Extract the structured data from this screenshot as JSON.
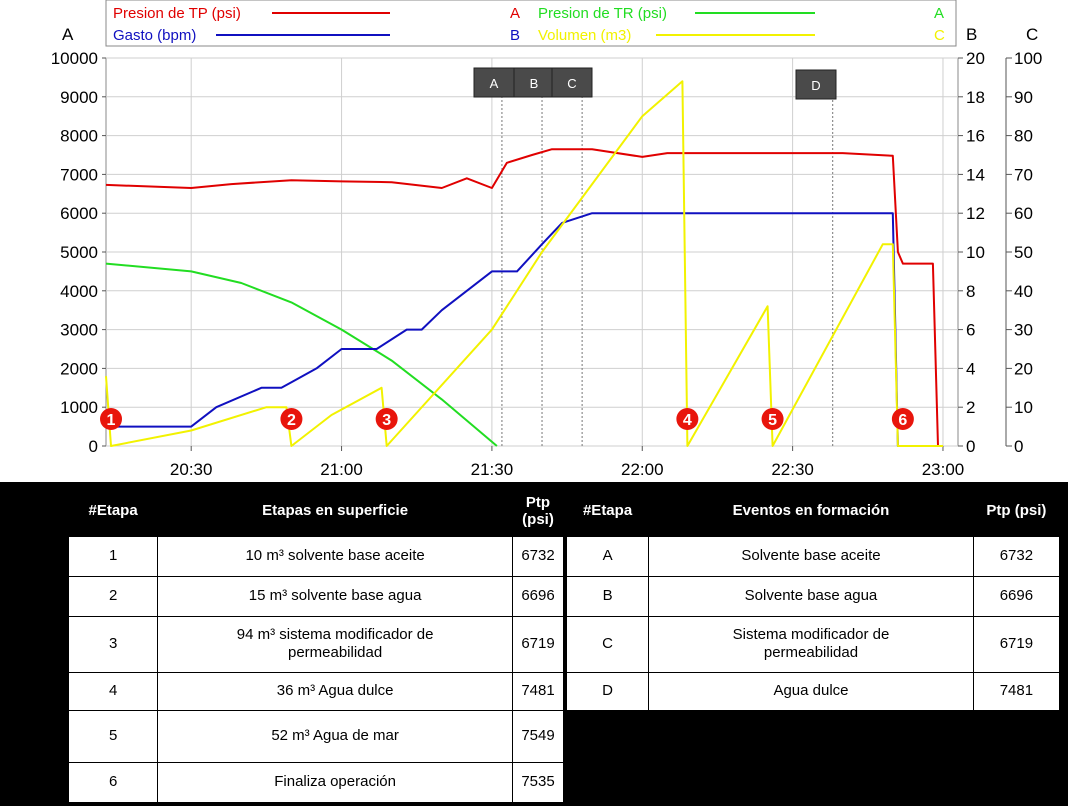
{
  "chart_data": {
    "type": "line",
    "x_ticks": [
      "20:30",
      "21:00",
      "21:30",
      "22:00",
      "22:30",
      "23:00"
    ],
    "x_range": [
      "20:13",
      "23:03"
    ],
    "axes": {
      "A": {
        "label": "A",
        "range": [
          0,
          10000
        ],
        "ticks": [
          "0",
          "1000",
          "2000",
          "3000",
          "4000",
          "5000",
          "6000",
          "7000",
          "8000",
          "9000",
          "10000"
        ]
      },
      "B": {
        "label": "B",
        "range": [
          0,
          20
        ],
        "ticks": [
          "0",
          "2",
          "4",
          "6",
          "8",
          "10",
          "12",
          "14",
          "16",
          "18",
          "20"
        ]
      },
      "C": {
        "label": "C",
        "range": [
          0,
          100
        ],
        "ticks": [
          "0",
          "10",
          "20",
          "30",
          "40",
          "50",
          "60",
          "70",
          "80",
          "90",
          "100"
        ]
      }
    },
    "legend": [
      {
        "name": "Presion de TP (psi)",
        "axis": "A",
        "color": "#e00000"
      },
      {
        "name": "Presion de TR (psi)",
        "axis": "A",
        "color": "#22dd22"
      },
      {
        "name": "Gasto (bpm)",
        "axis": "B",
        "color": "#1010c0"
      },
      {
        "name": "Volumen (m3)",
        "axis": "C",
        "color": "#f2f200"
      }
    ],
    "series": [
      {
        "name": "Presion de TP (psi)",
        "axis": "A",
        "color": "#e00000",
        "x": [
          "20:13",
          "20:30",
          "20:38",
          "20:50",
          "21:00",
          "21:10",
          "21:20",
          "21:25",
          "21:30",
          "21:33",
          "21:38",
          "21:42",
          "21:50",
          "22:00",
          "22:05",
          "22:15",
          "22:30",
          "22:40",
          "22:50",
          "22:51",
          "22:52",
          "22:58",
          "22:59",
          "23:00"
        ],
        "values": [
          6730,
          6650,
          6750,
          6850,
          6820,
          6800,
          6650,
          6900,
          6650,
          7300,
          7500,
          7650,
          7650,
          7450,
          7550,
          7550,
          7550,
          7550,
          7480,
          5000,
          4700,
          4700,
          0,
          0
        ]
      },
      {
        "name": "Presion de TR (psi)",
        "axis": "A",
        "color": "#22dd22",
        "x": [
          "20:13",
          "20:30",
          "20:40",
          "20:50",
          "21:00",
          "21:10",
          "21:20",
          "21:31"
        ],
        "values": [
          4700,
          4500,
          4200,
          3700,
          3000,
          2200,
          1200,
          0
        ]
      },
      {
        "name": "Gasto (bpm)",
        "axis": "B",
        "color": "#1010c0",
        "x": [
          "20:13",
          "20:30",
          "20:35",
          "20:44",
          "20:48",
          "20:55",
          "21:00",
          "21:07",
          "21:13",
          "21:16",
          "21:20",
          "21:30",
          "21:35",
          "21:40",
          "21:44",
          "21:50",
          "22:00",
          "22:30",
          "22:50",
          "22:51",
          "23:00"
        ],
        "values": [
          1,
          1,
          2,
          3,
          3,
          4,
          5,
          5,
          6,
          6,
          7,
          9,
          9,
          10.4,
          11.5,
          12,
          12,
          12,
          12,
          0,
          0
        ]
      },
      {
        "name": "Volumen (m3)",
        "axis": "C",
        "color": "#f2f200",
        "x": [
          "20:13",
          "20:14",
          "20:30",
          "20:45",
          "20:49",
          "20:50",
          "20:58",
          "21:08",
          "21:09",
          "21:30",
          "21:40",
          "22:00",
          "22:08",
          "22:09",
          "22:25",
          "22:26",
          "22:48",
          "22:50",
          "22:51",
          "23:00"
        ],
        "values": [
          18,
          0,
          4,
          10,
          10,
          0,
          8,
          15,
          0,
          30,
          50,
          85,
          94,
          0,
          36,
          0,
          52,
          52,
          0,
          0
        ]
      }
    ],
    "event_markers": [
      "A",
      "B",
      "C",
      "D"
    ],
    "stage_markers": [
      "1",
      "2",
      "3",
      "4",
      "5",
      "6"
    ]
  },
  "colors": {
    "tp": "#e00000",
    "tr": "#22dd22",
    "gasto": "#1010c0",
    "volumen": "#f2f200",
    "marker": "#e8150c",
    "event_box": "#4a4a4a"
  },
  "table_left": {
    "headers": [
      "#Etapa",
      "Etapas en superficie",
      "Ptp (psi)"
    ],
    "rows": [
      [
        "1",
        "10 m³ solvente base aceite",
        "6732"
      ],
      [
        "2",
        "15 m³ solvente base agua",
        "6696"
      ],
      [
        "3",
        "94 m³ sistema modificador de permeabilidad",
        "6719"
      ],
      [
        "4",
        "36 m³ Agua dulce",
        "7481"
      ],
      [
        "5",
        "52 m³ Agua de mar",
        "7549"
      ],
      [
        "6",
        "Finaliza operación",
        "7535"
      ]
    ]
  },
  "table_right": {
    "headers": [
      "#Etapa",
      "Eventos en formación",
      "Ptp (psi)"
    ],
    "rows": [
      [
        "A",
        "Solvente base aceite",
        "6732"
      ],
      [
        "B",
        "Solvente base agua",
        "6696"
      ],
      [
        "C",
        "Sistema modificador de permeabilidad",
        "6719"
      ],
      [
        "D",
        "Agua dulce",
        "7481"
      ]
    ]
  }
}
